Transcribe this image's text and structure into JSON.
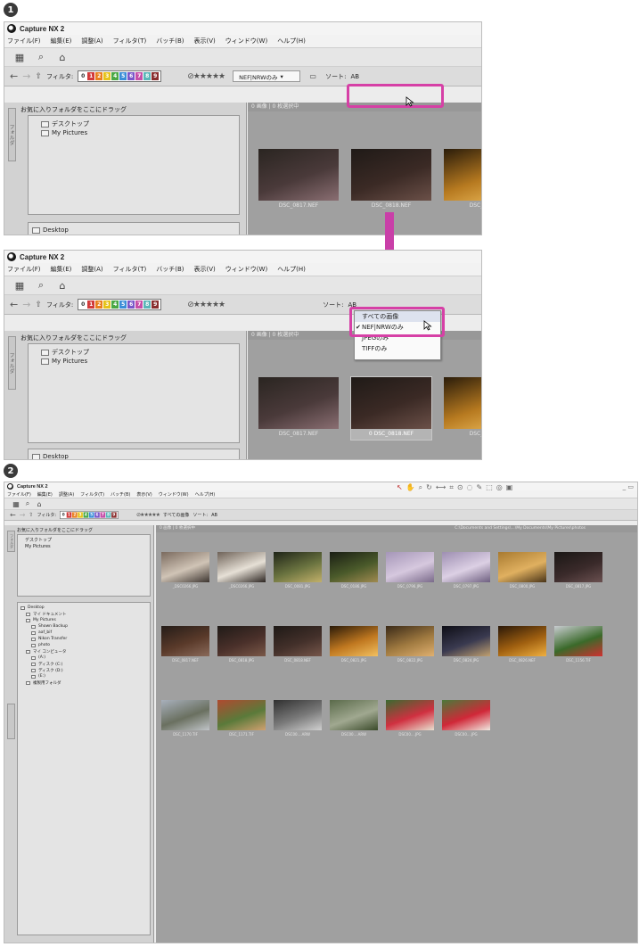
{
  "steps": {
    "step1": "1",
    "step2": "2"
  },
  "app": {
    "title": "Capture NX 2"
  },
  "menu": [
    "ファイル(F)",
    "編集(E)",
    "調整(A)",
    "フィルタ(T)",
    "バッチ(B)",
    "表示(V)",
    "ウィンドウ(W)",
    "ヘルプ(H)"
  ],
  "filter_bar": {
    "filter_label": "フィルタ:",
    "labels": [
      "0",
      "1",
      "2",
      "3",
      "4",
      "5",
      "6",
      "7",
      "8",
      "9"
    ],
    "label_colors": [
      "#ffffff",
      "#d23a3a",
      "#e97f1e",
      "#e6c21a",
      "#4aa845",
      "#3b8ed8",
      "#7a57c9",
      "#c64fa8",
      "#5ab6b8",
      "#8a2f2f"
    ],
    "sort_label": "ソート:",
    "sort_value": "AB",
    "combo_value": "NEF|NRWのみ",
    "combo_value_big": "すべての画像"
  },
  "dropdown": {
    "items": [
      "すべての画像",
      "NEF|NRWのみ",
      "JPEGのみ",
      "TIFFのみ"
    ],
    "highlighted": 0,
    "checked": 1
  },
  "left_panel": {
    "fav_header": "お気に入りフォルダをここにドラッグ",
    "fav_items": [
      "デスクトップ",
      "My Pictures"
    ],
    "folder_tab": "フォルダ",
    "desktop_item": "Desktop"
  },
  "browser": {
    "status": "0 画像 | 0 枚選択中",
    "path_right": "C:\\Documents and Settings\\...\\My Documents\\My Pictures\\photos"
  },
  "thumbs_small": [
    {
      "name": "DSC_0817.NEF",
      "colors": [
        "#2a2521",
        "#4a3a3a",
        "#8a6e72"
      ]
    },
    {
      "name": "DSC_0818.NEF",
      "colors": [
        "#1f1a17",
        "#3b2a25",
        "#6b5048"
      ]
    },
    {
      "name": "DSC_082...",
      "colors": [
        "#2a1c0a",
        "#b77a20",
        "#f0c060"
      ]
    }
  ],
  "selected_thumb_label": "0",
  "big_tree": {
    "items": [
      "Desktop",
      "マイ ドキュメント",
      "My Pictures",
      "Shown Backup",
      "aaf_bif",
      "Nikon Transfer",
      "photo",
      "マイ コンピュータ",
      "(A:)",
      "ディスク (C:)",
      "ディスク (D:)",
      "(E:)",
      "複製用フォルダ"
    ]
  },
  "big_thumbs": [
    {
      "name": "_DSC0266.JPG",
      "colors": [
        "#7a6a5e",
        "#d0c4b6",
        "#3d3530"
      ]
    },
    {
      "name": "_DSC0266.JPG",
      "colors": [
        "#6e6258",
        "#e6e0d6",
        "#2d2622"
      ]
    },
    {
      "name": "DSC_0081.JPG",
      "colors": [
        "#1f2418",
        "#6b7440",
        "#c2b06a"
      ]
    },
    {
      "name": "DSC_0186.JPG",
      "colors": [
        "#1a1e14",
        "#4a5a2a",
        "#a08a50"
      ]
    },
    {
      "name": "DSC_0796.JPG",
      "colors": [
        "#a596b8",
        "#d6c8de",
        "#7a6a8a"
      ]
    },
    {
      "name": "DSC_0797.JPG",
      "colors": [
        "#9e8fb2",
        "#dcd0e4",
        "#6e5f80"
      ]
    },
    {
      "name": "DSC_0800.JPG",
      "colors": [
        "#a87a30",
        "#e0b060",
        "#4a3418"
      ]
    },
    {
      "name": "DSC_0817.JPG",
      "colors": [
        "#1a1715",
        "#3a2a2a",
        "#6a5050"
      ]
    },
    {
      "name": "DSC_0817.NEF",
      "colors": [
        "#241c18",
        "#5a3a2a",
        "#8a6a5a"
      ]
    },
    {
      "name": "DSC_0818.JPG",
      "colors": [
        "#1f1a17",
        "#4a302a",
        "#7a5848"
      ]
    },
    {
      "name": "DSC_0818.NEF",
      "colors": [
        "#1e1916",
        "#43302a",
        "#76564a"
      ]
    },
    {
      "name": "DSC_0821.JPG",
      "colors": [
        "#2a1a08",
        "#c07820",
        "#f2c060"
      ]
    },
    {
      "name": "DSC_0822.JPG",
      "colors": [
        "#3a2a18",
        "#a07a40",
        "#e0b070"
      ]
    },
    {
      "name": "DSC_0824.JPG",
      "colors": [
        "#0e0e16",
        "#3a3a50",
        "#c0a070"
      ]
    },
    {
      "name": "DSC_0826.NEF",
      "colors": [
        "#2a1808",
        "#a06010",
        "#f0b040"
      ]
    },
    {
      "name": "DSC_1156.TIF",
      "colors": [
        "#c8ccd0",
        "#3a6a2a",
        "#d03030"
      ]
    },
    {
      "name": "DSC_1170.TIF",
      "colors": [
        "#a8b0bc",
        "#6a7060",
        "#c0c4c8"
      ]
    },
    {
      "name": "DSC_1171.TIF",
      "colors": [
        "#b04a30",
        "#5a7a3a",
        "#d0a070"
      ]
    },
    {
      "name": "DSC00....ARW",
      "colors": [
        "#303030",
        "#7a7a7a",
        "#d0d0d0"
      ]
    },
    {
      "name": "DSC00....ARW",
      "colors": [
        "#5a6a4a",
        "#a0a890",
        "#3a4a2a"
      ]
    },
    {
      "name": "DSC00....JPG",
      "colors": [
        "#3a6a30",
        "#d03040",
        "#e8e0d0"
      ]
    },
    {
      "name": "DSC00....JPG",
      "colors": [
        "#4a7a3a",
        "#d02838",
        "#f0e8e0"
      ]
    }
  ],
  "colors": {
    "accent": "#d640a6",
    "arrow": "#c93fa8",
    "browser_bg": "#a0a0a0",
    "selection": "#3d5aa8"
  }
}
